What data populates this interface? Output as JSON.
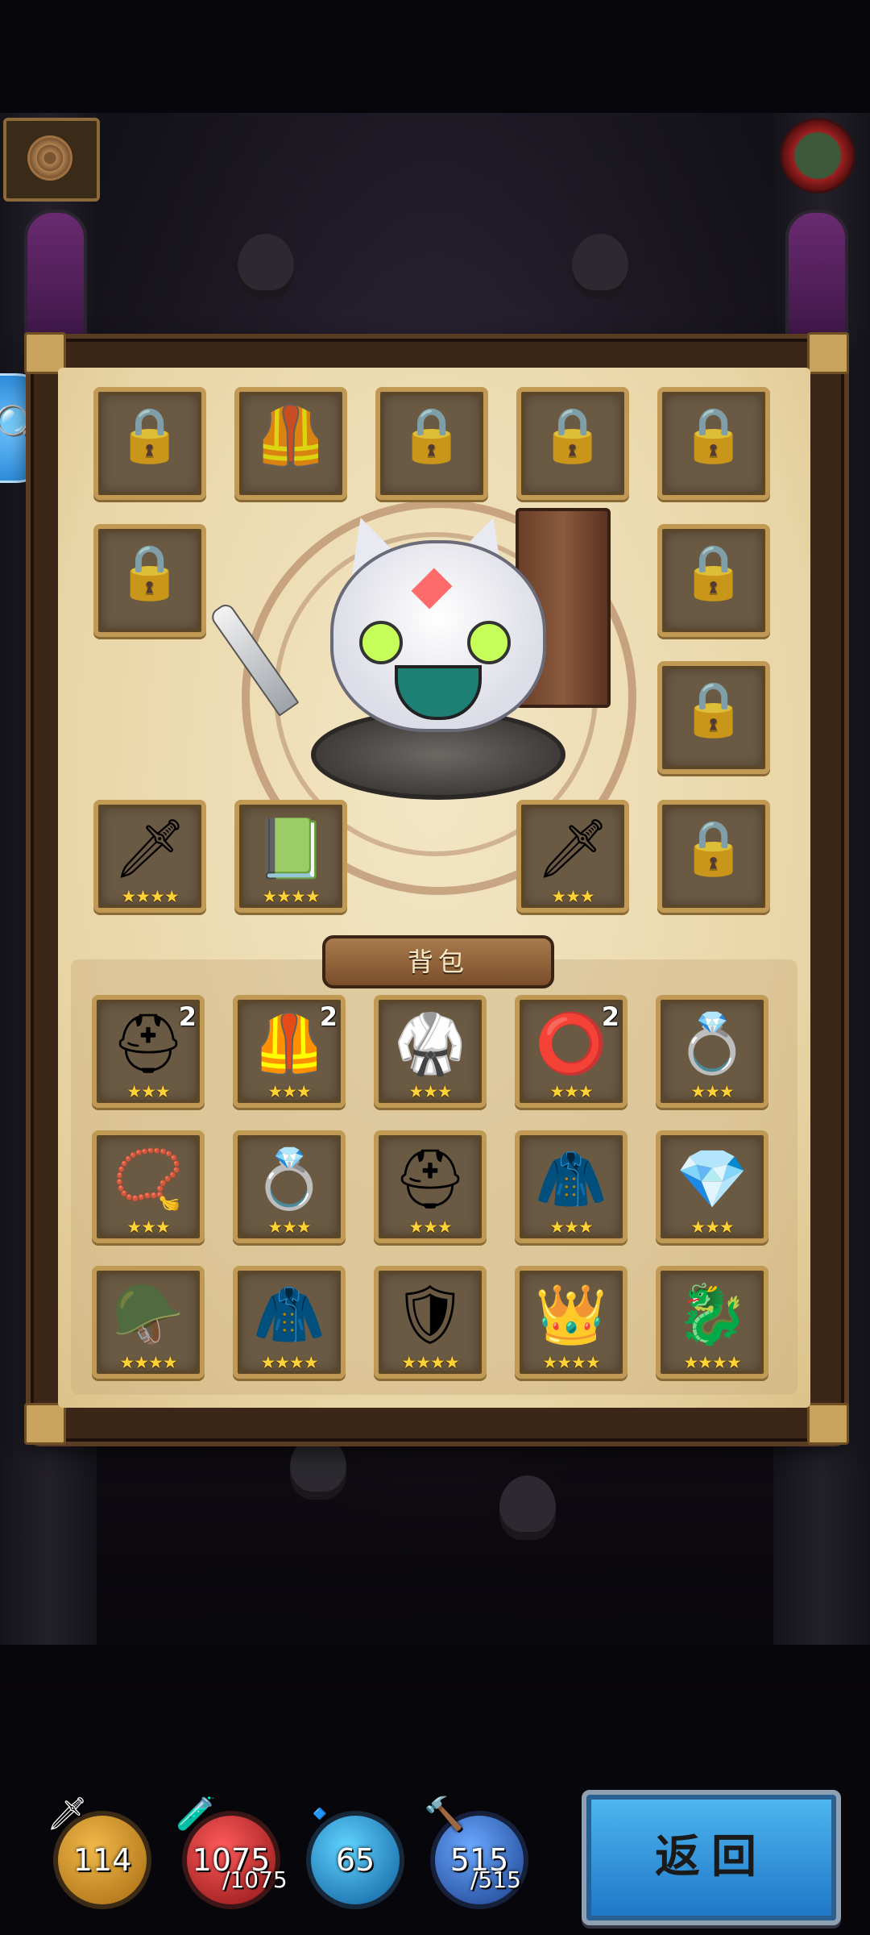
{
  "colors": {
    "slot_border": "#c09a55",
    "star": "#ffd23a",
    "panel_bg": "#efdfb8",
    "back_button": "#2f8fd8"
  },
  "hud": {
    "left_button_icon": "target-icon",
    "right_button_icon": "avatar-icon",
    "side_button_icon": "magnifier-icon"
  },
  "equipment": {
    "row1": [
      {
        "icon": "lock-icon",
        "glyph": "🔒"
      },
      {
        "icon": "armor-outline-icon",
        "glyph": "🦺"
      },
      {
        "icon": "lock-icon",
        "glyph": "🔒"
      },
      {
        "icon": "lock-icon",
        "glyph": "🔒"
      },
      {
        "icon": "lock-icon",
        "glyph": "🔒"
      }
    ],
    "left_col": [
      {
        "icon": "lock-icon",
        "glyph": "🔒"
      }
    ],
    "right_col": [
      {
        "icon": "lock-icon",
        "glyph": "🔒"
      },
      {
        "icon": "lock-icon",
        "glyph": "🔒"
      }
    ],
    "bottom": [
      {
        "icon": "sword-icon",
        "glyph": "🗡",
        "stars": "★★★★"
      },
      {
        "icon": "spellbook-icon",
        "glyph": "📗",
        "stars": "★★★★"
      },
      {
        "icon": "sword-icon",
        "glyph": "🗡",
        "stars": "★★★"
      },
      {
        "icon": "lock-icon",
        "glyph": "🔒"
      }
    ]
  },
  "backpack": {
    "title": "背包",
    "items": [
      {
        "icon": "helmet-icon",
        "glyph": "⛑",
        "stars": "★★★",
        "count": "2"
      },
      {
        "icon": "chest-armor-icon",
        "glyph": "🦺",
        "stars": "★★★",
        "count": "2"
      },
      {
        "icon": "dark-armor-icon",
        "glyph": "🥋",
        "stars": "★★★",
        "count": ""
      },
      {
        "icon": "belt-icon",
        "glyph": "⭕",
        "stars": "★★★",
        "count": "2"
      },
      {
        "icon": "gold-ring-icon",
        "glyph": "💍",
        "stars": "★★★",
        "count": ""
      },
      {
        "icon": "necklace-icon",
        "glyph": "📿",
        "stars": "★★★",
        "count": ""
      },
      {
        "icon": "ruby-ring-icon",
        "glyph": "💍",
        "stars": "★★★",
        "count": ""
      },
      {
        "icon": "crimson-helmet-icon",
        "glyph": "⛑",
        "stars": "★★★",
        "count": ""
      },
      {
        "icon": "purple-cape-icon",
        "glyph": "🧥",
        "stars": "★★★",
        "count": ""
      },
      {
        "icon": "gem-ring-icon",
        "glyph": "💎",
        "stars": "★★★",
        "count": ""
      },
      {
        "icon": "winged-helmet-icon",
        "glyph": "🪖",
        "stars": "★★★★",
        "count": ""
      },
      {
        "icon": "blue-cloak-icon",
        "glyph": "🧥",
        "stars": "★★★★",
        "count": ""
      },
      {
        "icon": "bracer-icon",
        "glyph": "🛡",
        "stars": "★★★★",
        "count": ""
      },
      {
        "icon": "gold-pauldron-icon",
        "glyph": "👑",
        "stars": "★★★★",
        "count": ""
      },
      {
        "icon": "serpent-ring-icon",
        "glyph": "🐉",
        "stars": "★★★★",
        "count": ""
      }
    ]
  },
  "stats": {
    "attack": "114",
    "hp": "1075",
    "hp_max": "/1075",
    "mana": "65",
    "shield": "515",
    "shield_max": "/515"
  },
  "back_button_label": "返回"
}
